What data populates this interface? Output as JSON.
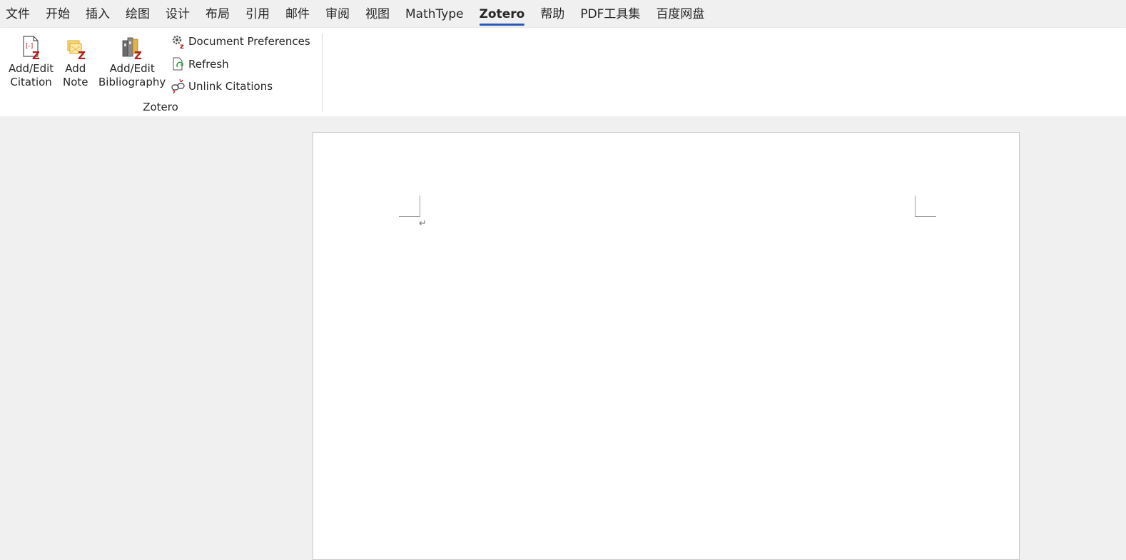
{
  "tabs": [
    {
      "label": "文件"
    },
    {
      "label": "开始"
    },
    {
      "label": "插入"
    },
    {
      "label": "绘图"
    },
    {
      "label": "设计"
    },
    {
      "label": "布局"
    },
    {
      "label": "引用"
    },
    {
      "label": "邮件"
    },
    {
      "label": "审阅"
    },
    {
      "label": "视图"
    },
    {
      "label": "MathType"
    },
    {
      "label": "Zotero"
    },
    {
      "label": "帮助"
    },
    {
      "label": "PDF工具集"
    },
    {
      "label": "百度网盘"
    }
  ],
  "active_tab": "Zotero",
  "ribbon": {
    "group_label": "Zotero",
    "add_edit_citation": {
      "line1": "Add/Edit",
      "line2": "Citation"
    },
    "add_note": {
      "line1": "Add",
      "line2": "Note"
    },
    "add_edit_bibliography": {
      "line1": "Add/Edit",
      "line2": "Bibliography"
    },
    "document_preferences": "Document Preferences",
    "refresh": "Refresh",
    "unlink_citations": "Unlink Citations"
  },
  "document": {
    "paragraph_mark": "↵"
  },
  "colors": {
    "accent": "#2a5ab8",
    "zotero_red": "#b01e1e"
  }
}
